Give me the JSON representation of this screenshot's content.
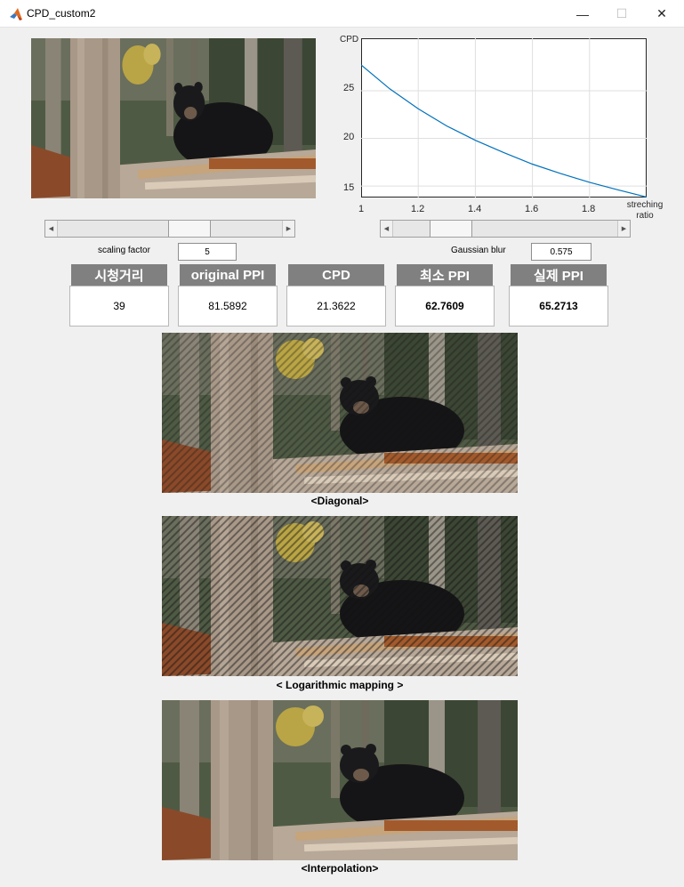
{
  "window": {
    "title": "CPD_custom2",
    "minimize_glyph": "—",
    "maximize_glyph": "☐",
    "close_glyph": "✕",
    "icon": "matlab-icon"
  },
  "plot": {
    "ylabel": "CPD",
    "xlabel_line1": "streching",
    "xlabel_line2": "ratio",
    "xticks": [
      "1",
      "1.2",
      "1.4",
      "1.6",
      "1.8"
    ],
    "yticks": [
      "15",
      "20",
      "25"
    ]
  },
  "chart_data": {
    "type": "line",
    "ylabel": "CPD",
    "xlabel": "streching ratio",
    "xlim": [
      1,
      2
    ],
    "ylim": [
      13.8,
      30.5
    ],
    "grid": true,
    "series": [
      {
        "color": "#0072bd",
        "x": [
          1.0,
          1.1,
          1.2,
          1.3,
          1.4,
          1.5,
          1.6,
          1.7,
          1.8,
          1.9,
          2.0
        ],
        "y": [
          27.7,
          25.2,
          23.1,
          21.3,
          19.8,
          18.5,
          17.3,
          16.3,
          15.4,
          14.6,
          13.85
        ]
      }
    ]
  },
  "controls": {
    "scaling_label": "scaling factor",
    "scaling_value": "5",
    "scaling_slider_level": 0.6,
    "blur_label": "Gaussian blur",
    "blur_value": "0.575",
    "blur_slider_level": 0.2
  },
  "metrics": [
    {
      "title": "시청거리",
      "value": "39"
    },
    {
      "title": "original PPI",
      "value": "81.5892"
    },
    {
      "title": "CPD",
      "value": "21.3622"
    },
    {
      "title": "최소 PPI",
      "value": "62.7609"
    },
    {
      "title": "실제 PPI",
      "value": "65.2713"
    }
  ],
  "captions": {
    "diagonal": "<Diagonal>",
    "logarithmic": "< Logarithmic mapping >",
    "interpolation": "<Interpolation>"
  },
  "image_subject": "bear-in-forest-photo"
}
